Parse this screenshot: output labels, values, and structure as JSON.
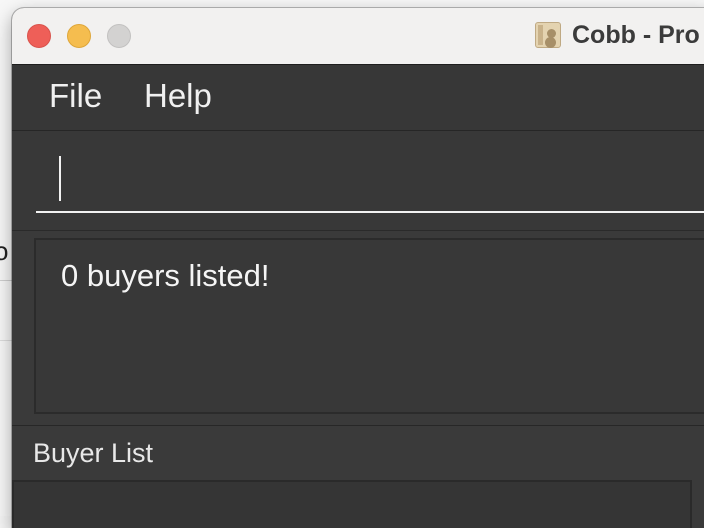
{
  "window": {
    "title": "Cobb - Pro"
  },
  "background": {
    "fragment_text": "o"
  },
  "menu": {
    "items": [
      "File",
      "Help"
    ]
  },
  "command_box": {
    "value": "",
    "placeholder": ""
  },
  "result_display": {
    "text": "0 buyers listed!"
  },
  "buyer_list": {
    "label": "Buyer List"
  },
  "colors": {
    "window_bg": "#3a3a3a",
    "titlebar_bg": "#f2f1f0",
    "close": "#ee5f58",
    "minimize": "#f5bd4f",
    "maximize": "#d3d2d1",
    "text": "#f5f5f5"
  },
  "icons": {
    "app_icon": "address-book-icon"
  }
}
